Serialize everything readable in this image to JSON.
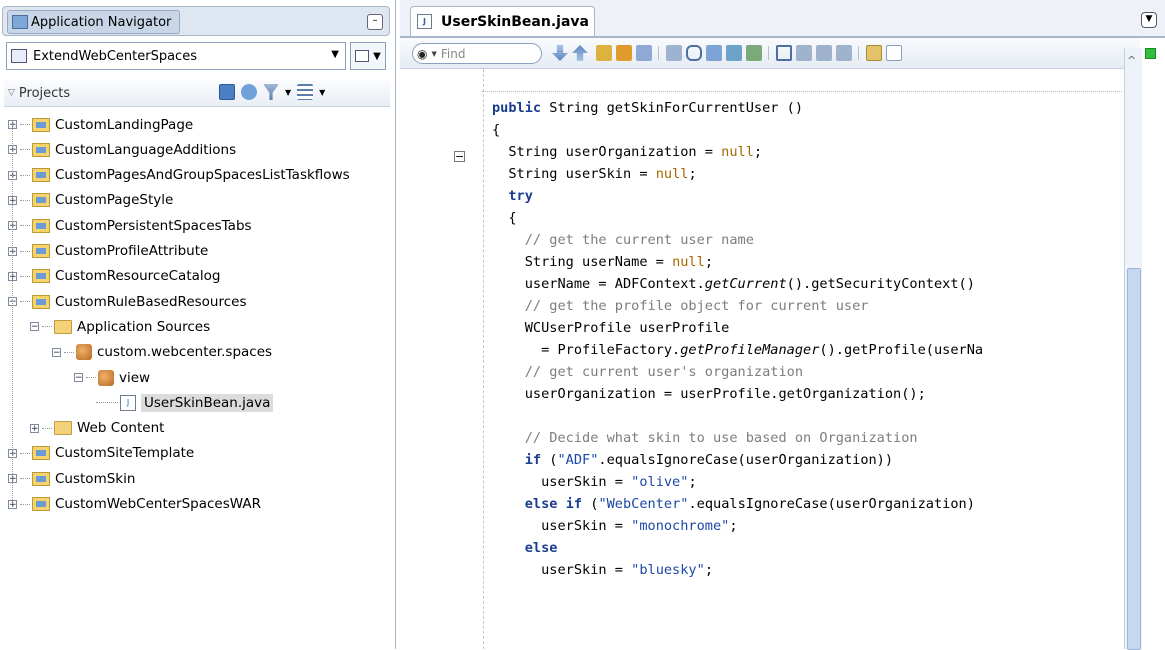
{
  "navigator": {
    "title": "Application Navigator",
    "minimize_label": "–",
    "application": "ExtendWebCenterSpaces",
    "projects_label": "Projects",
    "tree": [
      {
        "label": "CustomLandingPage",
        "kind": "project",
        "level": 0,
        "expander": "+"
      },
      {
        "label": "CustomLanguageAdditions",
        "kind": "project",
        "level": 0,
        "expander": "+"
      },
      {
        "label": "CustomPagesAndGroupSpacesListTaskflows",
        "kind": "project",
        "level": 0,
        "expander": "+"
      },
      {
        "label": "CustomPageStyle",
        "kind": "project",
        "level": 0,
        "expander": "+"
      },
      {
        "label": "CustomPersistentSpacesTabs",
        "kind": "project",
        "level": 0,
        "expander": "+"
      },
      {
        "label": "CustomProfileAttribute",
        "kind": "project",
        "level": 0,
        "expander": "+"
      },
      {
        "label": "CustomResourceCatalog",
        "kind": "project",
        "level": 0,
        "expander": "+"
      },
      {
        "label": "CustomRuleBasedResources",
        "kind": "project",
        "level": 0,
        "expander": "-"
      },
      {
        "label": "Application Sources",
        "kind": "source-folder",
        "level": 1,
        "expander": "-"
      },
      {
        "label": "custom.webcenter.spaces",
        "kind": "package",
        "level": 2,
        "expander": "-"
      },
      {
        "label": "view",
        "kind": "package",
        "level": 3,
        "expander": "-"
      },
      {
        "label": "UserSkinBean.java",
        "kind": "java-file",
        "level": 4,
        "expander": "",
        "selected": true
      },
      {
        "label": "Web Content",
        "kind": "source-folder",
        "level": 1,
        "expander": "+"
      },
      {
        "label": "CustomSiteTemplate",
        "kind": "project",
        "level": 0,
        "expander": "+"
      },
      {
        "label": "CustomSkin",
        "kind": "project",
        "level": 0,
        "expander": "+"
      },
      {
        "label": "CustomWebCenterSpacesWAR",
        "kind": "project",
        "level": 0,
        "expander": "+"
      }
    ]
  },
  "editor": {
    "tab_title": "UserSkinBean.java",
    "find_placeholder": "Find",
    "code": [
      "public String getSkinForCurrentUser ()",
      "{",
      "  String userOrganization = null;",
      "  String userSkin = null;",
      "  try",
      "  {",
      "    // get the current user name",
      "    String userName = null;",
      "    userName = ADFContext.getCurrent().getSecurityContext()",
      "    // get the profile object for current user",
      "    WCUserProfile userProfile",
      "      = ProfileFactory.getProfileManager().getProfile(userNa",
      "    // get current user's organization",
      "    userOrganization = userProfile.getOrganization();",
      "",
      "    // Decide what skin to use based on Organization",
      "    if (\"ADF\".equalsIgnoreCase(userOrganization))",
      "      userSkin = \"olive\";",
      "    else if (\"WebCenter\".equalsIgnoreCase(userOrganization)",
      "      userSkin = \"monochrome\";",
      "    else",
      "      userSkin = \"bluesky\";"
    ]
  },
  "colors": {
    "keyword": "#1b3d8f",
    "string": "#1d47a8",
    "null": "#a36a00",
    "comment": "#7d7d7d",
    "selection": "#dcdcdc",
    "accent": "#a9b7c9"
  }
}
